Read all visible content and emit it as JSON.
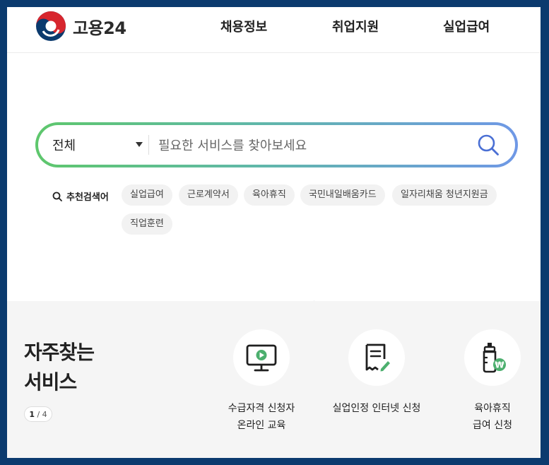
{
  "header": {
    "logo_text": "고용24",
    "nav": [
      "채용정보",
      "취업지원",
      "실업급여"
    ]
  },
  "search": {
    "category": "전체",
    "placeholder": "필요한 서비스를 찾아보세요"
  },
  "keywords": {
    "label": "추천검색어",
    "items": [
      "실업급여",
      "근로계약서",
      "육아휴직",
      "국민내일배움카드",
      "일자리채움 청년지원금",
      "직업훈련"
    ]
  },
  "services": {
    "title_line1": "자주찾는",
    "title_line2": "서비스",
    "pager_current": "1",
    "pager_total": "/ 4",
    "items": [
      {
        "line1": "수급자격 신청자",
        "line2": "온라인 교육",
        "icon": "monitor-play-icon"
      },
      {
        "line1": "실업인정 인터넷 신청",
        "line2": "",
        "icon": "document-pen-icon"
      },
      {
        "line1": "육아휴직",
        "line2": "급여 신청",
        "icon": "baby-bottle-won-icon"
      }
    ]
  },
  "colors": {
    "frame": "#0b3a6e",
    "gradient_start": "#5ec76c",
    "gradient_end": "#6f98e6",
    "search_icon": "#4a6fd4",
    "accent_green": "#5ec76c"
  }
}
